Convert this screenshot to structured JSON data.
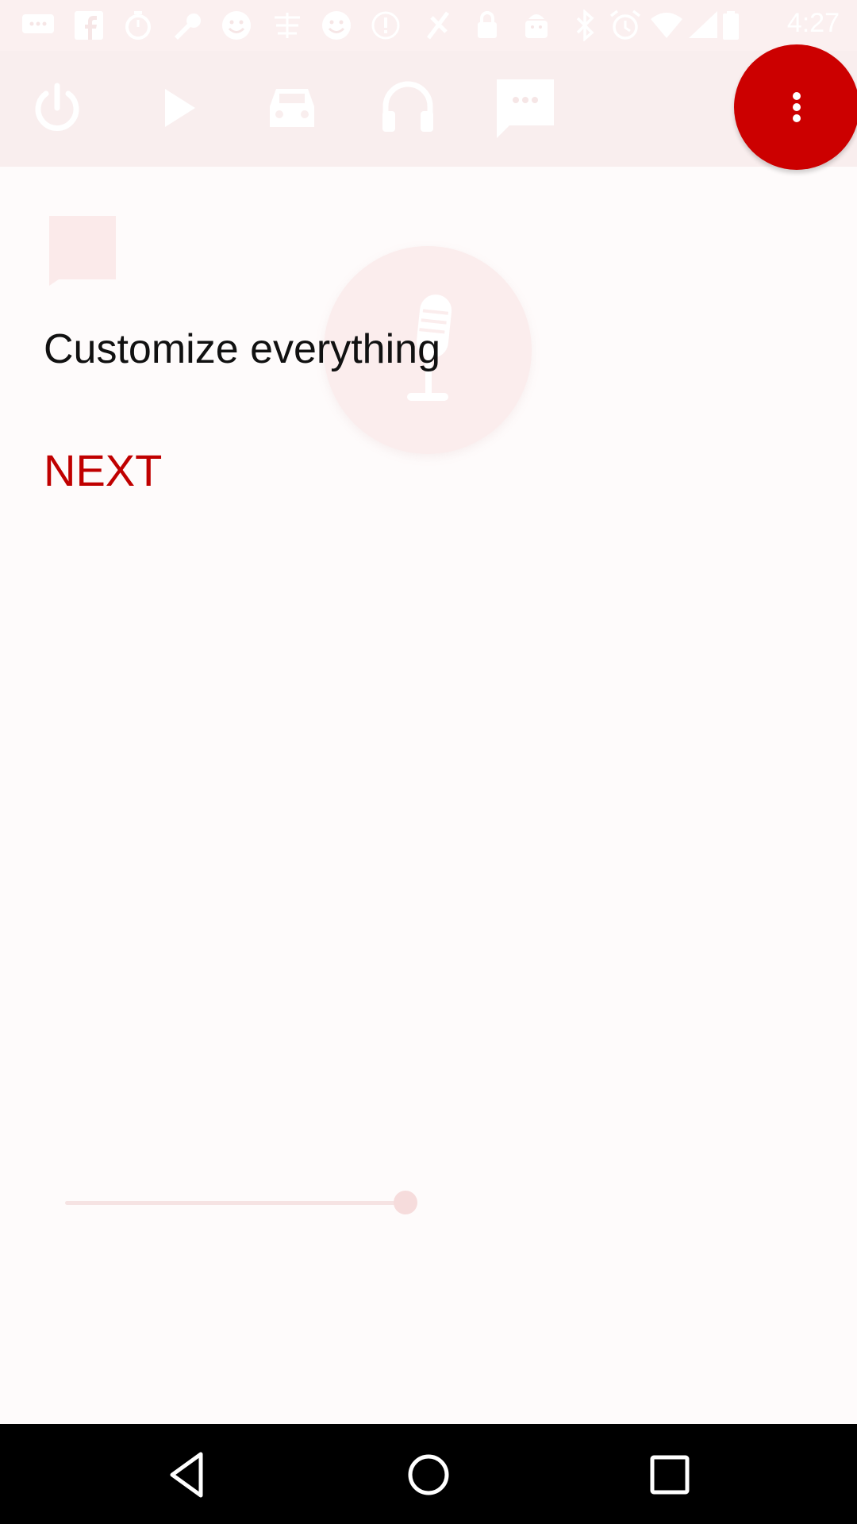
{
  "status_bar": {
    "time": "4:27",
    "notification_icons": [
      "chat-icon",
      "facebook-icon",
      "timer-icon",
      "wrench-icon",
      "smiley-icon",
      "taobao-icon",
      "smiley-icon",
      "alert-icon",
      "free-antenna-icon",
      "lock-icon",
      "android-icon"
    ],
    "system_icons": [
      "bluetooth-icon",
      "alarm-icon",
      "wifi-icon",
      "signal-icon",
      "battery-icon"
    ]
  },
  "toolbar": {
    "icons": [
      "power-icon",
      "play-icon",
      "car-icon",
      "headphones-icon",
      "message-icon"
    ],
    "overflow_icon": "more-vert-icon"
  },
  "intro": {
    "bubble_icon": "chat-bubble-icon",
    "mic_icon": "microphone-icon",
    "heading": "Customize everything",
    "next_label": "NEXT"
  },
  "progress": {
    "value": 0.48
  },
  "nav_bar": {
    "buttons": [
      "back-icon",
      "home-icon",
      "recents-icon"
    ]
  },
  "colors": {
    "accent": "#cc0000",
    "next_text": "#c00000",
    "toolbar_bg": "#f9eeee",
    "page_bg": "#fefbfb",
    "nav_bg": "#000000"
  }
}
